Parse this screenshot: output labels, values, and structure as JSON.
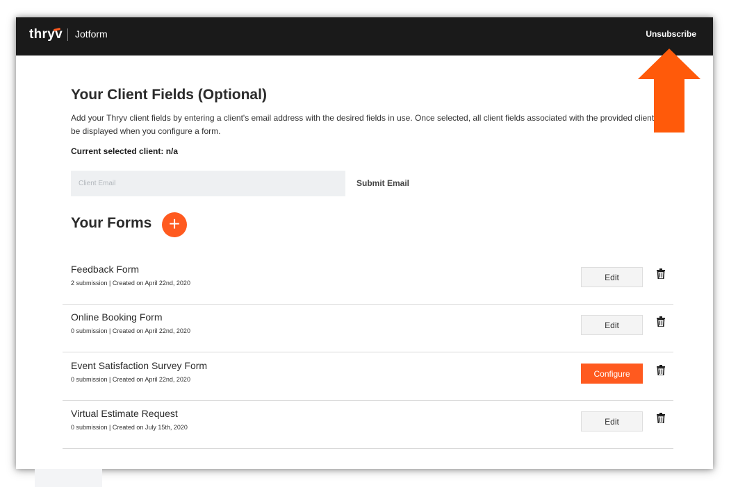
{
  "header": {
    "brand": "thryv",
    "product": "Jotform",
    "unsubscribe_label": "Unsubscribe"
  },
  "client_fields": {
    "title": "Your Client Fields (Optional)",
    "description": "Add your Thryv client fields by entering a client's email address with the desired fields in use. Once selected, all client fields associated with the provided client will be displayed when you configure a form.",
    "current_label": "Current selected client: n/a",
    "email_placeholder": "Client Email",
    "submit_label": "Submit Email"
  },
  "forms": {
    "title": "Your Forms",
    "add_symbol": "+",
    "items": [
      {
        "name": "Feedback Form",
        "meta": "2 submission | Created on April 22nd, 2020",
        "action": "Edit"
      },
      {
        "name": "Online Booking Form",
        "meta": "0 submission | Created on April 22nd, 2020",
        "action": "Edit"
      },
      {
        "name": "Event Satisfaction Survey Form",
        "meta": "0 submission | Created on April 22nd, 2020",
        "action": "Configure"
      },
      {
        "name": "Virtual Estimate Request",
        "meta": "0 submission | Created on July 15th, 2020",
        "action": "Edit"
      }
    ]
  },
  "colors": {
    "accent": "#ff5a1f",
    "header_bg": "#1a1a1a",
    "input_bg": "#eef0f2"
  },
  "icons": {
    "delete": "trash-icon",
    "annotation": "up-arrow-icon"
  }
}
